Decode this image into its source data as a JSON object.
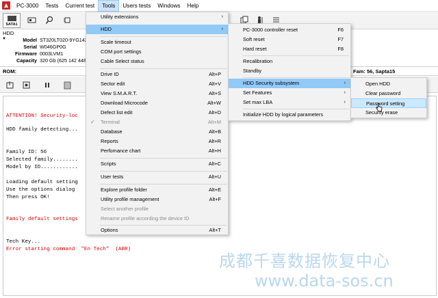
{
  "menubar": {
    "items": [
      "PC-3000",
      "Tests",
      "Current test",
      "Tools",
      "Users tests",
      "Windows",
      "Help"
    ]
  },
  "toolbar": {
    "sata_label": "SATA1"
  },
  "hdd": {
    "title": "HDD",
    "rows": [
      {
        "label": "Model",
        "value": "ST320LT020-9YG142"
      },
      {
        "label": "Serial",
        "value": "W046GP0G"
      },
      {
        "label": "Firmware",
        "value": "0003LVM1"
      },
      {
        "label": "Capacity",
        "value": "320 Gb (625 142 448"
      }
    ]
  },
  "rom": {
    "label": "ROM:",
    "fam": "Fam: 56, Sapta15"
  },
  "log": [
    {
      "text": "ATTENTION! Security-loc",
      "color": "red"
    },
    {
      "text": "HDD family detecting...",
      "color": "black"
    },
    {
      "text": "Family ID: 56",
      "color": "black"
    },
    {
      "text": "Selected family........",
      "color": "black"
    },
    {
      "text": "Model by ID............",
      "color": "black"
    },
    {
      "text": "Loading default setting",
      "color": "black"
    },
    {
      "text": "Use the options dialog",
      "color": "black"
    },
    {
      "text": "Then press OK!",
      "color": "black"
    },
    {
      "text": "Family default settings",
      "color": "red"
    },
    {
      "text": "Tech Key...",
      "color": "black"
    },
    {
      "text": "Error starting command  \"En Tech\"  (ABR)",
      "color": "red"
    }
  ],
  "tools_menu": {
    "items": [
      {
        "label": "Utility extensions",
        "shortcut": "",
        "arrow": true
      },
      {
        "label": "HDD",
        "shortcut": "",
        "arrow": true,
        "state": "selected"
      },
      {
        "label": "Scale timeout",
        "shortcut": ""
      },
      {
        "label": "COM port settings",
        "shortcut": ""
      },
      {
        "label": "Cable Select status",
        "shortcut": ""
      },
      {
        "label": "Drive ID",
        "shortcut": "Alt+P"
      },
      {
        "label": "Sector edit",
        "shortcut": "Alt+V"
      },
      {
        "label": "View S.M.A.R.T.",
        "shortcut": "Alt+S"
      },
      {
        "label": "Download Microcode",
        "shortcut": "Alt+W"
      },
      {
        "label": "Defect list edit",
        "shortcut": "Alt+D"
      },
      {
        "label": "Terminal",
        "shortcut": "Alt+M",
        "state": "disabled",
        "check": true
      },
      {
        "label": "Database",
        "shortcut": "Alt+B"
      },
      {
        "label": "Reports",
        "shortcut": "Alt+R"
      },
      {
        "label": "Perfomance chart",
        "shortcut": "Alt+H"
      },
      {
        "label": "Scripts",
        "shortcut": "Alt+C"
      },
      {
        "label": "User tests",
        "shortcut": "Alt+U"
      },
      {
        "label": "Explore profile folder",
        "shortcut": "Alt+E"
      },
      {
        "label": "Utility profile management",
        "shortcut": "Alt+F"
      },
      {
        "label": "Select another profile",
        "shortcut": "",
        "state": "disabled"
      },
      {
        "label": "Rename profile according the device ID",
        "shortcut": "",
        "state": "disabled"
      },
      {
        "label": "Options",
        "shortcut": "Alt+T"
      }
    ]
  },
  "hdd_menu": {
    "items": [
      {
        "label": "PC-3000 controller reset",
        "shortcut": "F6"
      },
      {
        "label": "Soft reset",
        "shortcut": "F7"
      },
      {
        "label": "Hard reset",
        "shortcut": "F8"
      },
      {
        "label": "Recalibration",
        "shortcut": ""
      },
      {
        "label": "Standby",
        "shortcut": ""
      },
      {
        "label": "HDD Security subsystem",
        "shortcut": "",
        "arrow": true,
        "state": "selected"
      },
      {
        "label": "Set Features",
        "shortcut": "",
        "arrow": true
      },
      {
        "label": "Set max LBA",
        "shortcut": "",
        "arrow": true
      },
      {
        "label": "Initialize HDD by logical parameters",
        "shortcut": ""
      }
    ]
  },
  "security_menu": {
    "items": [
      {
        "label": "Open HDD",
        "shortcut": ""
      },
      {
        "label": "Clear password",
        "shortcut": ""
      },
      {
        "label": "Password setting",
        "shortcut": "",
        "state": "highlighted"
      },
      {
        "label": "Security erase",
        "shortcut": ""
      }
    ]
  },
  "watermark": {
    "cn": "成都千喜数据恢复中心",
    "url": "www.data-sos.cn"
  },
  "colors": {
    "selected": "#91c9f7",
    "highlight": "#cce8ff",
    "error_text": "#d20000",
    "watermark": "#b9d7ef"
  }
}
